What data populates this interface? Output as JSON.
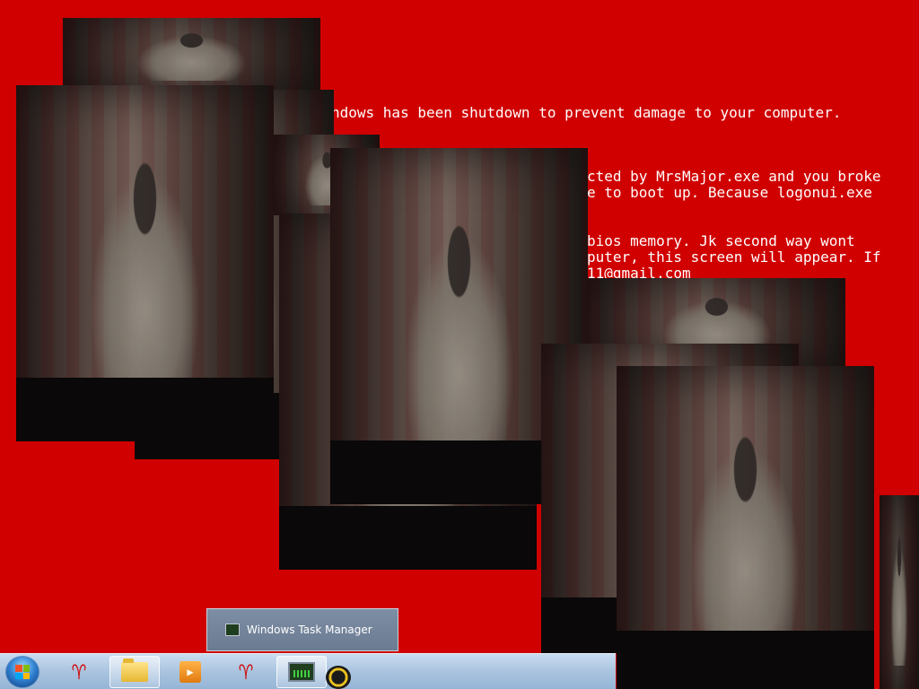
{
  "message": {
    "line1": "ndows has been shutdown to prevent damage to your computer.",
    "line2": ":",
    "line3": "cted by MrsMajor.exe and you broke",
    "line4": "e to boot up. Because logonui.exe",
    "line5": "bios memory. Jk second way wont",
    "line6": "puter, this screen will appear. If",
    "line7": "11@gmail.com"
  },
  "background_color": "#d00000",
  "popups": {
    "count": 9,
    "icon": "horror-photo"
  },
  "taskbar": {
    "start_icon": "windows-start-orb-icon",
    "items": [
      {
        "name": "ram-skull-icon",
        "active": false
      },
      {
        "name": "folder-icon",
        "active": true
      },
      {
        "name": "media-player-icon",
        "active": false
      },
      {
        "name": "ram-skull-icon",
        "active": false
      },
      {
        "name": "task-manager-icon",
        "active": true
      }
    ],
    "tray_badge_icon": "hazard-badge-icon"
  },
  "thumbnail_popup": {
    "label": "Windows Task Manager",
    "icon": "task-manager-icon"
  }
}
